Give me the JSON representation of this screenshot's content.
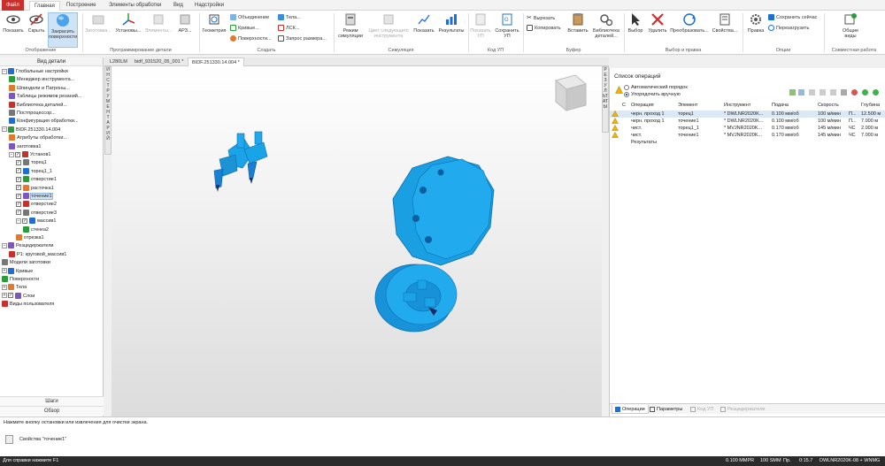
{
  "menu": {
    "tabs": [
      "Файл",
      "Главная",
      "Построение",
      "Элементы обработки",
      "Вид",
      "Надстройки"
    ]
  },
  "ribbon": {
    "display": {
      "show": "Показать",
      "hide": "Скрыть",
      "shade_line1": "Закрасить",
      "shade_line2": "поверхности",
      "group": "Отображение"
    },
    "setup": {
      "stock": "Заготовка...",
      "setups": "Установы...",
      "elements": "Элементы...",
      "arz": "АРЗ...",
      "group": "Программирование детали"
    },
    "create": {
      "geometry": "Геометрия",
      "union": "Объединение",
      "curves": "Кривые...",
      "surfaces": "Поверхности...",
      "bodies": "Тела...",
      "lsk": "ЛСК...",
      "size_query": "Запрос размера...",
      "group": "Создать"
    },
    "sim": {
      "mode_line1": "Режим",
      "mode_line2": "симуляции",
      "next_color_line1": "Цвет следующего",
      "next_color_line2": "инструмента",
      "show": "Показать",
      "results": "Результаты",
      "group": "Симуляция"
    },
    "nc": {
      "show_line1": "Показать",
      "show_line2": "УП",
      "save_line1": "Сохранить",
      "save_line2": "УП",
      "group": "Код УП"
    },
    "buffer": {
      "cut": "Вырезать",
      "copy": "Копировать",
      "paste": "Вставить",
      "library_line1": "Библиотека",
      "library_line2": "деталей...",
      "group": "Буфер"
    },
    "select": {
      "select": "Выбор",
      "delete": "Удалить",
      "transform": "Преобразовать...",
      "properties": "Свойства...",
      "group": "Выбор и правка"
    },
    "options": {
      "rule": "Правка",
      "save_now": "Сохранить сейчас",
      "reload": "Перезагрузить",
      "group": "Опции"
    },
    "collab": {
      "views_line1": "Общие",
      "views_line2": "виды",
      "group": "Совместная работа"
    }
  },
  "left": {
    "header": "Вид детали",
    "tree": [
      {
        "label": "Глобальные настройки",
        "icon": "globe-icon",
        "indent": 0,
        "exp": "−"
      },
      {
        "label": "Менеджер инструмента...",
        "icon": "tool-manager-icon",
        "indent": 1
      },
      {
        "label": "Шпиндели и Патроны...",
        "icon": "spindle-icon",
        "indent": 1
      },
      {
        "label": "Таблицы режимов резаний...",
        "icon": "table-icon",
        "indent": 1
      },
      {
        "label": "Библиотека деталей...",
        "icon": "library-icon",
        "indent": 1
      },
      {
        "label": "Постпроцессор...",
        "icon": "post-icon",
        "indent": 1
      },
      {
        "label": "Конфигурация обработки...",
        "icon": "config-icon",
        "indent": 1
      },
      {
        "label": "BIDF.251330.14.004",
        "icon": "part-icon",
        "indent": 0,
        "exp": "−"
      },
      {
        "label": "Атрибуты обработки...",
        "icon": "attributes-icon",
        "indent": 1
      },
      {
        "label": "заготовка1",
        "icon": "stock-icon",
        "indent": 1
      },
      {
        "label": "Установ1",
        "icon": "setup-icon",
        "indent": 1,
        "exp": "−",
        "cb": true
      },
      {
        "label": "торец1",
        "icon": "face-icon",
        "indent": 2,
        "cb": true
      },
      {
        "label": "торец1_1",
        "icon": "face-icon",
        "indent": 2,
        "cb": true
      },
      {
        "label": "отверстие1",
        "icon": "hole-icon",
        "indent": 2,
        "cb": true
      },
      {
        "label": "расточка1",
        "icon": "bore-icon",
        "indent": 2,
        "cb": true
      },
      {
        "label": "точение1",
        "icon": "turn-icon",
        "indent": 2,
        "cb": true,
        "sel": true
      },
      {
        "label": "отверстие2",
        "icon": "hole-icon",
        "indent": 2,
        "cb": true
      },
      {
        "label": "отверстие3",
        "icon": "hole-icon",
        "indent": 2,
        "cb": true
      },
      {
        "label": "массив1",
        "icon": "pattern-icon",
        "indent": 2,
        "exp": "−",
        "cb": true
      },
      {
        "label": "стенка2",
        "icon": "wall-icon",
        "indent": 3
      },
      {
        "label": "отрезка1",
        "icon": "cutoff-icon",
        "indent": 2
      },
      {
        "label": "Резцедержатели",
        "icon": "holder-icon",
        "indent": 0,
        "exp": "−"
      },
      {
        "label": "P1: круговой_массив1",
        "icon": "pattern-icon",
        "indent": 1
      },
      {
        "label": "Модели заготовки",
        "icon": "models-icon",
        "indent": 0
      },
      {
        "label": "Кривые",
        "icon": "curves-icon",
        "indent": 0,
        "exp": "+"
      },
      {
        "label": "Поверхности",
        "icon": "surfaces-icon",
        "indent": 0
      },
      {
        "label": "Тела",
        "icon": "bodies-icon",
        "indent": 0,
        "exp": "+"
      },
      {
        "label": "Слои",
        "icon": "layers-icon",
        "indent": 0,
        "exp": "+",
        "cb": true
      },
      {
        "label": "Виды пользователя",
        "icon": "views-icon",
        "indent": 0
      }
    ],
    "vtab": "ИНСТРУМЕНТАРИЙ",
    "steps": "Шаги",
    "overview": "Обзор"
  },
  "doctabs": [
    "L280LM",
    "bidf_931520_05_001 *",
    "BIDF.251330.14.004 *"
  ],
  "right": {
    "vtab": "РЕЗУЛЬТАТЫ",
    "title": "Список операций",
    "auto_order": "Автоматический порядок",
    "manual_order": "Упорядочить вручную",
    "headers": [
      "С",
      "Операция",
      "Элемент",
      "Инструмент",
      "Подача",
      "Скорость",
      "Глубина"
    ],
    "rows": [
      {
        "op": "черн. проход 1",
        "el": "торец1",
        "tool": "* DWLNR2020K...",
        "feed": "0.100 мм/об",
        "speed": "100 м/мин",
        "sp2": "П...",
        "depth": "12.500 м"
      },
      {
        "op": "черн. проход 1",
        "el": "точение1",
        "tool": "* DWLNR2020K...",
        "feed": "0.100 мм/об",
        "speed": "100 м/мин",
        "sp2": "П...",
        "depth": "7.000 м"
      },
      {
        "op": "чист.",
        "el": "торец1_1",
        "tool": "* MVJNR2020K...",
        "feed": "0.170 мм/об",
        "speed": "145 м/мин",
        "sp2": "ЧС",
        "depth": "2.000 м"
      },
      {
        "op": "чист.",
        "el": "точение1",
        "tool": "* MVJNR2020K...",
        "feed": "0.170 мм/об",
        "speed": "145 м/мин",
        "sp2": "ЧС",
        "depth": "7.000 м"
      }
    ],
    "results_row": "Результаты",
    "tabs": [
      "Операции",
      "Параметры",
      "Код УП",
      "Резцедержатели"
    ]
  },
  "message": {
    "hint": "Нажмите кнопку остановки или извлечения для очистки экрана.",
    "props": "Свойства \"точение1\""
  },
  "status": {
    "help": "Для справки нажмите F1",
    "s1": "0.100 MMPR",
    "s2": "100 SMM",
    "s3": "Пр.",
    "s4": "0:15.7",
    "s5": "DWLNR2020K-08 + WNMG"
  },
  "colors": {
    "accent": "#c9302c",
    "model": "#1aa3e6",
    "model_dark": "#0a6fb0",
    "selection": "#cfe3f7"
  }
}
